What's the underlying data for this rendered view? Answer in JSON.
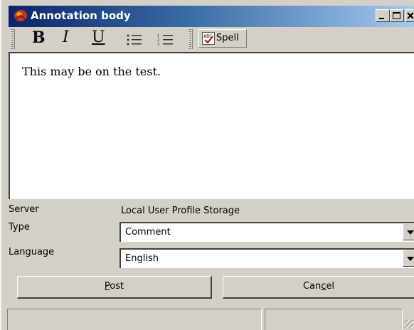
{
  "window": {
    "title": "Annotation body",
    "controls": {
      "minimize": "_",
      "maximize": "□",
      "close": "×"
    }
  },
  "toolbar": {
    "bold_label": "B",
    "italic_label": "I",
    "underline_label": "U",
    "bullet_list_icon": "bullet-list-icon",
    "numbered_list_icon": "numbered-list-icon",
    "spell_label": "Spell",
    "spell_icon": "spellcheck-icon"
  },
  "editor": {
    "text": "This may be on the test."
  },
  "form": {
    "server_label": "Server",
    "server_value": "Local User Profile Storage",
    "type_label": "Type",
    "type_value": "Comment",
    "language_label": "Language",
    "language_value": "English"
  },
  "buttons": {
    "post_prefix": "",
    "post_accel": "P",
    "post_rest": "ost",
    "cancel_prefix": "Can",
    "cancel_accel": "c",
    "cancel_rest": "el"
  },
  "colors": {
    "titlebar_start": "#0a246a",
    "titlebar_end": "#a6caf0",
    "face": "#d4d0c8"
  }
}
